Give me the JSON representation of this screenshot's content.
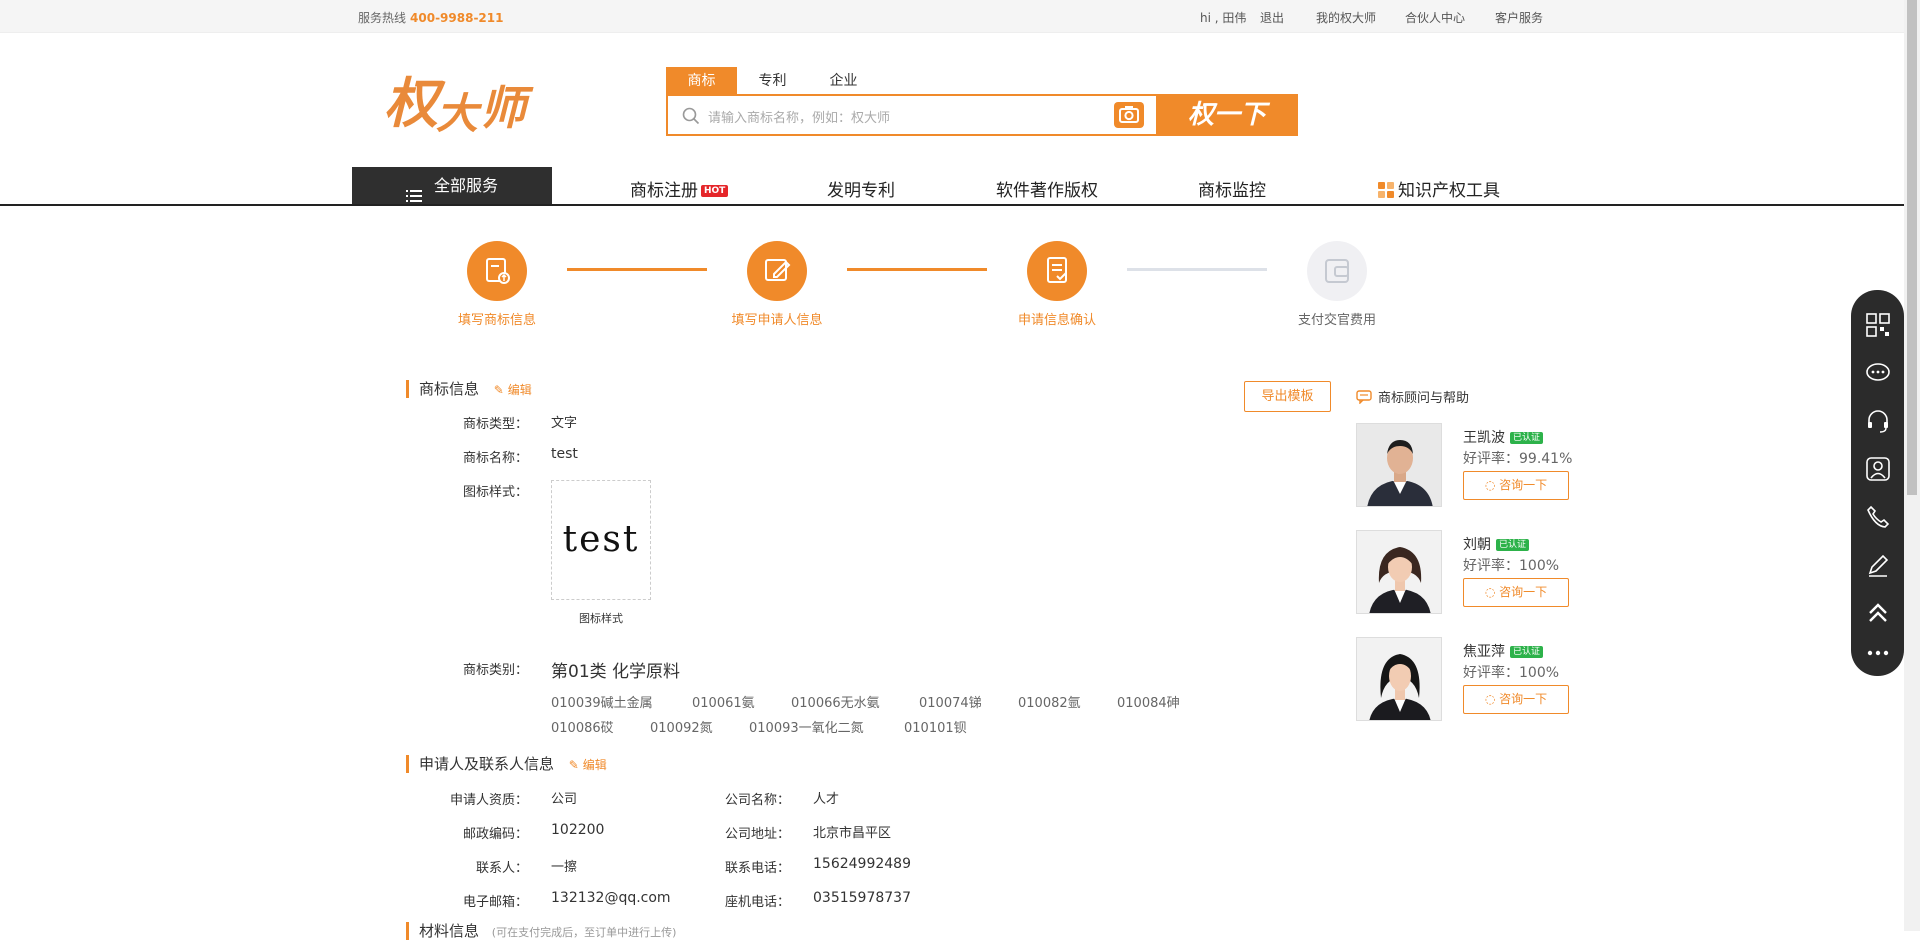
{
  "topbar": {
    "hotline_label": "服务热线",
    "hotline_number": "400-9988-211",
    "greeting": "hi , 田伟",
    "logout": "退出",
    "links": [
      "我的权大师",
      "合伙人中心",
      "客户服务"
    ]
  },
  "logo": {
    "text": "权大师"
  },
  "search": {
    "tabs": [
      "商标",
      "专利",
      "企业"
    ],
    "active_tab": 0,
    "placeholder": "请输入商标名称，例如：权大师",
    "button": "权一下"
  },
  "nav": {
    "all_services": "全部服务",
    "items": [
      "商标注册",
      "发明专利",
      "软件著作版权",
      "商标监控",
      "知识产权工具"
    ],
    "hot_badge": "HOT"
  },
  "steps": [
    {
      "label": "填写商标信息",
      "done": true
    },
    {
      "label": "填写申请人信息",
      "done": true
    },
    {
      "label": "申请信息确认",
      "done": true
    },
    {
      "label": "支付交官费用",
      "done": false
    }
  ],
  "trademark_info": {
    "title": "商标信息",
    "edit": "编辑",
    "export": "导出模板",
    "type_label": "商标类型：",
    "type_value": "文字",
    "name_label": "商标名称：",
    "name_value": "test",
    "style_label": "图标样式：",
    "style_image_text": "test",
    "style_caption": "图标样式",
    "class_label": "商标类别：",
    "class_value": "第01类 化学原料",
    "subclasses": [
      "010039碱土金属",
      "010061氨",
      "010066无水氨",
      "010074锑",
      "010082氩",
      "010084砷",
      "010086砹",
      "010092氮",
      "010093一氧化二氮",
      "010101钡"
    ]
  },
  "applicant_info": {
    "title": "申请人及联系人信息",
    "edit": "编辑",
    "fields": [
      {
        "label": "申请人资质：",
        "value": "公司"
      },
      {
        "label": "公司名称：",
        "value": "人才"
      },
      {
        "label": "邮政编码：",
        "value": "102200"
      },
      {
        "label": "公司地址：",
        "value": "北京市昌平区"
      },
      {
        "label": "联系人：",
        "value": "一擦"
      },
      {
        "label": "联系电话：",
        "value": "15624992489"
      },
      {
        "label": "电子邮箱：",
        "value": "132132@qq.com"
      },
      {
        "label": "座机电话：",
        "value": "03515978737"
      }
    ]
  },
  "material_info": {
    "title": "材料信息",
    "note": "(可在支付完成后，至订单中进行上传)"
  },
  "help": {
    "title": "商标顾问与帮助",
    "cert": "已认证",
    "consult": "咨询一下",
    "rate_label": "好评率：",
    "advisors": [
      {
        "name": "王凯波",
        "rate": "99.41%"
      },
      {
        "name": "刘朝",
        "rate": "100%"
      },
      {
        "name": "焦亚萍",
        "rate": "100%"
      }
    ]
  },
  "colors": {
    "accent": "#f08a2a",
    "dark": "#2f2f2f",
    "cert_green": "#2db24a",
    "hot_red": "#e5262a"
  },
  "side_toolbar": [
    "qrcode-icon",
    "chat-icon",
    "headset-icon",
    "user-icon",
    "phone-icon",
    "pen-icon",
    "top-icon",
    "more-icon"
  ]
}
